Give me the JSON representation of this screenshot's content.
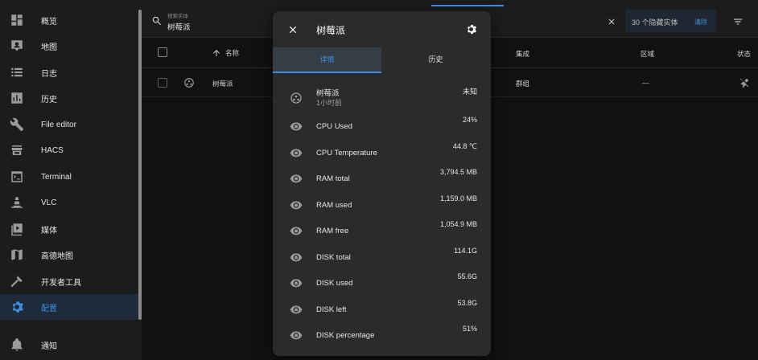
{
  "sidebar": {
    "items": [
      {
        "label": "概览",
        "icon": "dashboard-icon"
      },
      {
        "label": "地图",
        "icon": "map-person-icon"
      },
      {
        "label": "日志",
        "icon": "list-icon"
      },
      {
        "label": "历史",
        "icon": "chart-box-icon"
      },
      {
        "label": "File editor",
        "icon": "wrench-icon"
      },
      {
        "label": "HACS",
        "icon": "store-icon"
      },
      {
        "label": "Terminal",
        "icon": "terminal-icon"
      },
      {
        "label": "VLC",
        "icon": "cone-icon"
      },
      {
        "label": "媒体",
        "icon": "play-box-icon"
      },
      {
        "label": "高德地图",
        "icon": "map-icon"
      },
      {
        "label": "开发者工具",
        "icon": "hammer-icon"
      },
      {
        "label": "配置",
        "icon": "cog-icon",
        "active": true
      },
      {
        "label": "通知",
        "icon": "bell-icon"
      }
    ],
    "accent_color": "#3f8ee2"
  },
  "topbar": {
    "search_placeholder": "搜索实体",
    "search_value": "树莓派",
    "hidden_entities": "30 个隐藏实体",
    "clear_label": "清除"
  },
  "table": {
    "headers": {
      "name": "名称",
      "integration": "集成",
      "area": "区域",
      "status": "状态"
    },
    "row": {
      "name": "树莓派",
      "integration": "群组",
      "area": "—"
    }
  },
  "dialog": {
    "title": "树莓派",
    "tabs": [
      "详情",
      "历史"
    ],
    "group_entity": {
      "name": "树莓派",
      "subtitle": "1小时前",
      "value": "未知"
    },
    "entities": [
      {
        "name": "CPU Used",
        "value": "24%"
      },
      {
        "name": "CPU Temperature",
        "value": "44.8 ℃"
      },
      {
        "name": "RAM total",
        "value": "3,794.5 MB"
      },
      {
        "name": "RAM used",
        "value": "1,159.0 MB"
      },
      {
        "name": "RAM free",
        "value": "1,054.9 MB"
      },
      {
        "name": "DISK total",
        "value": "114.1G"
      },
      {
        "name": "DISK used",
        "value": "55.6G"
      },
      {
        "name": "DISK left",
        "value": "53.8G"
      },
      {
        "name": "DISK percentage",
        "value": "51%"
      }
    ]
  }
}
